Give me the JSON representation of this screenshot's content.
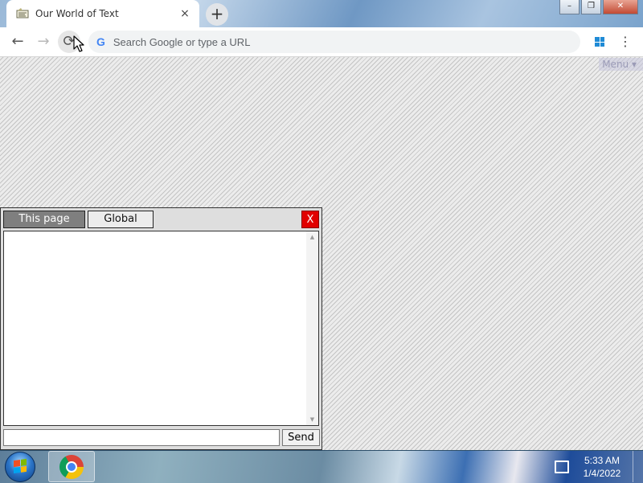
{
  "browser": {
    "tab_title": "Our World of Text",
    "tab_close": "×",
    "new_tab": "+",
    "nav": {
      "back": "←",
      "forward": "→",
      "reload": "⟳"
    },
    "omnibox": {
      "google_icon": "G",
      "placeholder": "Search Google or type a URL",
      "value": ""
    },
    "menu_dots": "⋮",
    "window_controls": {
      "minimize": "–",
      "maximize": "❐",
      "close": "✕"
    }
  },
  "page": {
    "menu_label": "Menu ▾"
  },
  "chat": {
    "tabs": [
      {
        "label": "This page",
        "active": true
      },
      {
        "label": "Global",
        "active": false
      }
    ],
    "close_label": "X",
    "input_value": "",
    "send_label": "Send",
    "scroll_up": "▲",
    "scroll_down": "▼"
  },
  "taskbar": {
    "time": "5:33 AM",
    "date": "1/4/2022"
  },
  "colors": {
    "chat_close": "#e10000",
    "active_tab": "#7f7f7f",
    "taskbar": "#4a7fb5"
  },
  "icons": [
    "favicon-icon",
    "back-arrow-icon",
    "forward-arrow-icon",
    "reload-icon",
    "google-g-icon",
    "windows-extension-icon",
    "menu-dots-icon",
    "cursor-icon",
    "start-orb-icon",
    "chrome-icon",
    "network-icon"
  ]
}
